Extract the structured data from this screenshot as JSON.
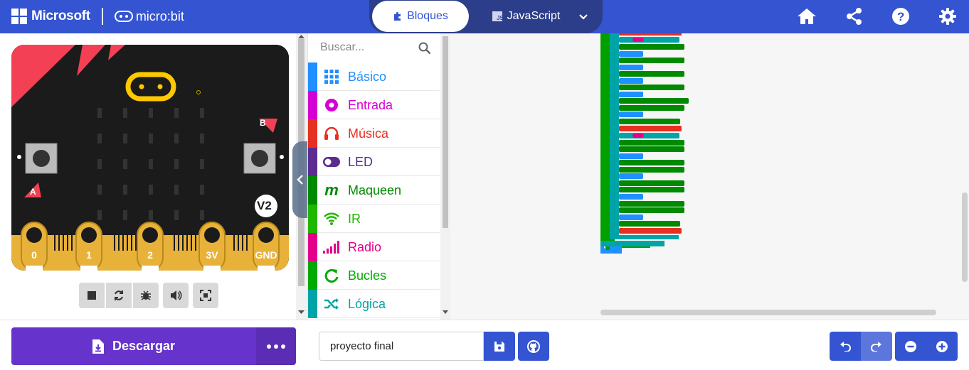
{
  "header": {
    "brand": "Microsoft",
    "product": "micro:bit",
    "tabs": [
      {
        "label": "Bloques",
        "icon": "puzzle-icon",
        "active": true
      },
      {
        "label": "JavaScript",
        "icon": "js-icon",
        "active": false
      }
    ],
    "actions": [
      "home-icon",
      "share-icon",
      "help-icon",
      "settings-icon"
    ]
  },
  "simulator": {
    "pins": [
      "0",
      "1",
      "2",
      "3V",
      "GND"
    ],
    "buttons": {
      "a": "A",
      "b": "B"
    },
    "version_badge": "V2",
    "controls": [
      "stop-icon",
      "restart-icon",
      "debug-icon",
      "mute-icon",
      "fullscreen-icon"
    ]
  },
  "toolbox": {
    "search_placeholder": "Buscar...",
    "categories": [
      {
        "label": "Básico",
        "color": "#1e90ff",
        "icon": "grid-icon"
      },
      {
        "label": "Entrada",
        "color": "#d400d4",
        "icon": "target-icon"
      },
      {
        "label": "Música",
        "color": "#e63022",
        "icon": "headphones-icon"
      },
      {
        "label": "LED",
        "color": "#5c2d91",
        "icon": "toggle-icon"
      },
      {
        "label": "Maqueen",
        "color": "#008a00",
        "icon": "maqueen-icon"
      },
      {
        "label": "IR",
        "color": "#1fb800",
        "icon": "wifi-icon"
      },
      {
        "label": "Radio",
        "color": "#e3008c",
        "icon": "signal-icon"
      },
      {
        "label": "Bucles",
        "color": "#00aa00",
        "icon": "loop-icon"
      },
      {
        "label": "Lógica",
        "color": "#00a4a6",
        "icon": "shuffle-icon"
      }
    ]
  },
  "footer": {
    "download_label": "Descargar",
    "project_name": "proyecto final"
  },
  "colors": {
    "header": "#3454d1",
    "download": "#6633cc"
  }
}
